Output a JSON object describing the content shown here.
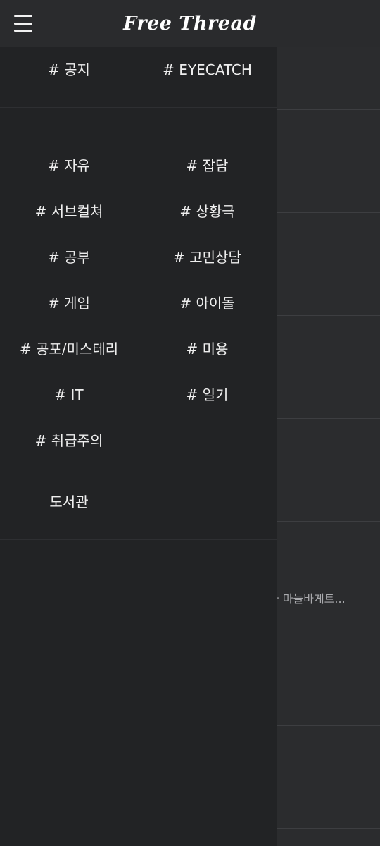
{
  "app": {
    "title": "Free Thread"
  },
  "drawer": {
    "notice_tags": [
      "# 공지",
      "# EYECATCH"
    ],
    "board_tags": [
      "# 자유",
      "# 잡담",
      "# 서브컬쳐",
      "# 상황극",
      "# 공부",
      "# 고민상담",
      "# 게임",
      "# 아이돌",
      "# 공포/미스테리",
      "# 미용",
      "# IT",
      "# 일기",
      "# 취급주의"
    ],
    "library_label": "도서관"
  },
  "feed": {
    "visible_snippet": "다 마늘바게트..."
  },
  "colors": {
    "topbar": "#2a2b2d",
    "drawer": "#222325",
    "background": "#2b2c2e",
    "text": "#eeeeee"
  },
  "icons": {
    "menu": "hamburger-menu-icon"
  }
}
